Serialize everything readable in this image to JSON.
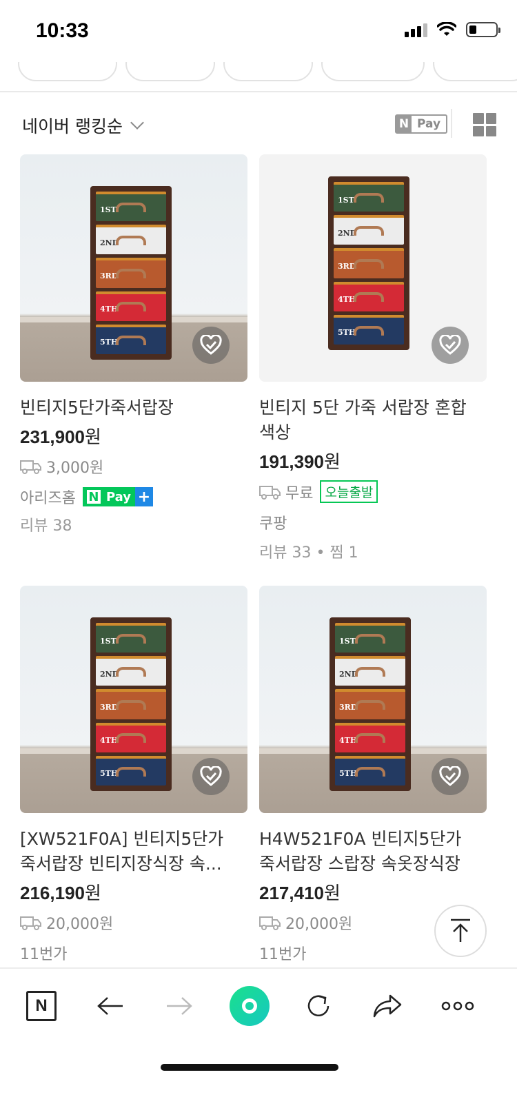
{
  "status_bar": {
    "time": "10:33"
  },
  "sort": {
    "label": "네이버 랭킹순",
    "npay_n": "N",
    "npay_text": "Pay"
  },
  "products": [
    {
      "title_line1": "빈티지5단가죽서랍장",
      "title_line2": "",
      "price": "231,900",
      "currency": "원",
      "shipping": "3,000원",
      "seller": "아리즈홈",
      "npay_plus": true,
      "meta": "리뷰 38"
    },
    {
      "title_line1": "빈티지 5단 가죽 서랍장 혼합",
      "title_line2": "색상",
      "price": "191,390",
      "currency": "원",
      "shipping": "무료",
      "badge": "오늘출발",
      "seller": "쿠팡",
      "meta": "리뷰 33 • 찜 1"
    },
    {
      "title_line1": "[XW521F0A] 빈티지5단가",
      "title_line2": "죽서랍장 빈티지장식장 속...",
      "price": "216,190",
      "currency": "원",
      "shipping": "20,000원",
      "seller": "11번가"
    },
    {
      "title_line1": "H4W521F0A 빈티지5단가",
      "title_line2": "죽서랍장 스랍장 속옷장식장",
      "price": "217,410",
      "currency": "원",
      "shipping": "20,000원",
      "seller": "11번가"
    }
  ],
  "drawer_tags": [
    "1ST",
    "2ND",
    "3RD",
    "4TH",
    "5TH"
  ],
  "npay_badge": {
    "n": "N",
    "pay": "Pay",
    "plus": "+"
  },
  "bottom_nav": {
    "home_letter": "N"
  },
  "colors": {
    "naver_green": "#03c75a",
    "accent_teal": "#19d6a6",
    "text_gray": "#8a8a8a"
  }
}
